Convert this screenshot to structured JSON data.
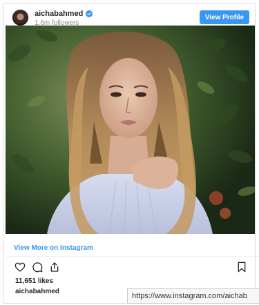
{
  "header": {
    "username": "aichabahmed",
    "verified_icon": "verified-badge-icon",
    "followers": "1.6m followers",
    "view_profile_label": "View Profile"
  },
  "post": {
    "view_more_label": "View More on Instagram",
    "likes": "11,651 likes",
    "caption_username": "aichabahmed"
  },
  "actions": {
    "like_icon": "heart-icon",
    "comment_icon": "comment-icon",
    "share_icon": "share-icon",
    "save_icon": "bookmark-icon"
  },
  "status_bar": {
    "url": "https://www.instagram.com/aichab"
  },
  "colors": {
    "accent": "#3897f0",
    "text": "#262626",
    "muted": "#8e8e8e",
    "border": "#dbdbdb"
  }
}
